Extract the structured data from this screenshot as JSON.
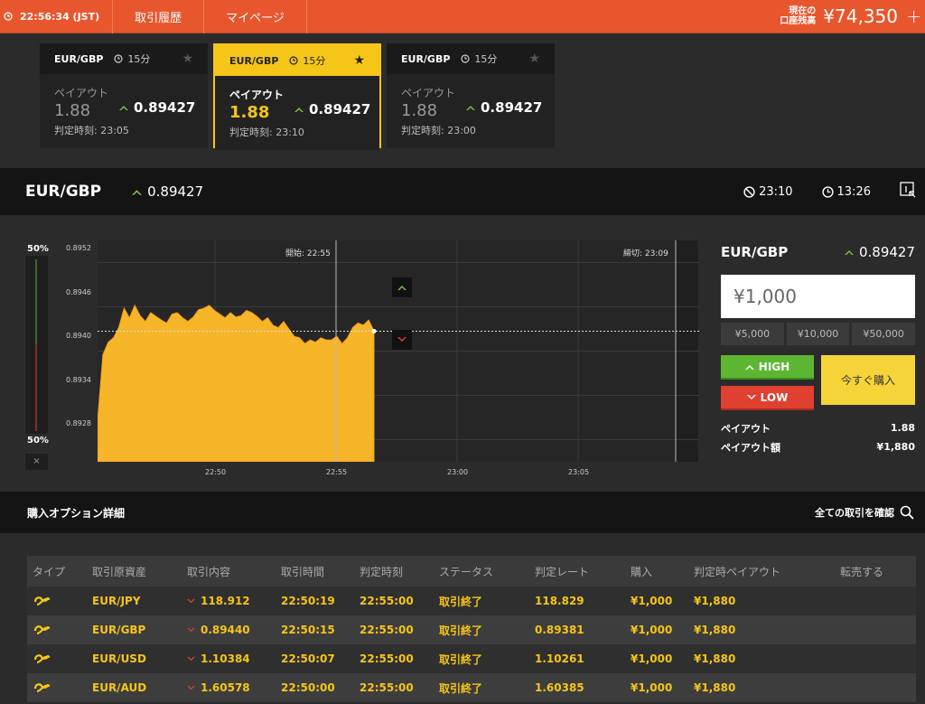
{
  "topbar": {
    "time": "22:56:34 (JST)",
    "nav_history": "取引履歴",
    "nav_mypage": "マイページ",
    "balance_label_1": "現在の",
    "balance_label_2": "口座残高",
    "balance_value": "¥74,350",
    "plus": "+"
  },
  "cards": [
    {
      "pair": "EUR/GBP",
      "duration": "15分",
      "payout_label": "ペイアウト",
      "payout": "1.88",
      "rate": "0.89427",
      "judge_label": "判定時刻: 23:05",
      "active": false
    },
    {
      "pair": "EUR/GBP",
      "duration": "15分",
      "payout_label": "ペイアウト",
      "payout": "1.88",
      "rate": "0.89427",
      "judge_label": "判定時刻: 23:10",
      "active": true
    },
    {
      "pair": "EUR/GBP",
      "duration": "15分",
      "payout_label": "ペイアウト",
      "payout": "1.88",
      "rate": "0.89427",
      "judge_label": "判定時刻: 23:00",
      "active": false
    }
  ],
  "assetbar": {
    "name": "EUR/GBP",
    "rate": "0.89427",
    "close_time": "23:10",
    "remaining": "13:26"
  },
  "chart": {
    "left_top_pct": "50%",
    "left_bottom_pct": "50%",
    "close_x": "×",
    "start_label": "開始: 22:55",
    "end_label": "締切: 23:09",
    "y_ticks": [
      "0.8952",
      "0.8946",
      "0.8940",
      "0.8934",
      "0.8928"
    ],
    "x_ticks": [
      "22:50",
      "22:55",
      "23:00",
      "23:05"
    ]
  },
  "chart_data": {
    "type": "area",
    "title": "",
    "xlabel": "",
    "ylabel": "",
    "ylim": [
      0.8925,
      0.8955
    ],
    "x": [
      "22:50",
      "22:55",
      "23:00",
      "23:05"
    ],
    "series": [
      {
        "values": [
          0.89305,
          0.89395,
          0.89412,
          0.89418,
          0.89432,
          0.89458,
          0.89445,
          0.89462,
          0.89448,
          0.8944,
          0.89452,
          0.89447,
          0.89442,
          0.89438,
          0.8945,
          0.89452,
          0.89445,
          0.8944,
          0.89446,
          0.89456,
          0.89458,
          0.89462,
          0.89455,
          0.8945,
          0.89445,
          0.89452,
          0.89446,
          0.89448,
          0.89455,
          0.89452,
          0.89447,
          0.8944,
          0.89445,
          0.89435,
          0.89432,
          0.8944,
          0.8943,
          0.8942,
          0.89418,
          0.8941,
          0.89415,
          0.89412,
          0.89418,
          0.89415,
          0.89415,
          0.8942,
          0.8941,
          0.89418,
          0.89432,
          0.89438,
          0.89435,
          0.89442,
          0.89427
        ]
      }
    ],
    "current_rate": 0.89427
  },
  "trade": {
    "name": "EUR/GBP",
    "rate": "0.89427",
    "amount": "¥1,000",
    "presets": [
      "¥5,000",
      "¥10,000",
      "¥50,000"
    ],
    "high": "HIGH",
    "low": "LOW",
    "buy": "今すぐ購入",
    "payout_label": "ペイアウト",
    "payout_value": "1.88",
    "payout_amount_label": "ペイアウト額",
    "payout_amount_value": "¥1,880"
  },
  "details": {
    "title": "購入オプション詳細",
    "all_link": "全ての取引を確認"
  },
  "table": {
    "headers": [
      "タイプ",
      "取引原資産",
      "取引内容",
      "取引時間",
      "判定時刻",
      "ステータス",
      "判定レート",
      "購入",
      "判定時ペイアウト",
      "転売する"
    ],
    "rows": [
      [
        "EUR/JPY",
        "118.912",
        "22:50:19",
        "22:55:00",
        "取引終了",
        "118.829",
        "¥1,000",
        "¥1,880"
      ],
      [
        "EUR/GBP",
        "0.89440",
        "22:50:15",
        "22:55:00",
        "取引終了",
        "0.89381",
        "¥1,000",
        "¥1,880"
      ],
      [
        "EUR/USD",
        "1.10384",
        "22:50:07",
        "22:55:00",
        "取引終了",
        "1.10261",
        "¥1,000",
        "¥1,880"
      ],
      [
        "EUR/AUD",
        "1.60578",
        "22:50:00",
        "22:55:00",
        "取引終了",
        "1.60385",
        "¥1,000",
        "¥1,880"
      ]
    ]
  },
  "colors": {
    "topbar": "#e8562e",
    "accent_yellow": "#f5c518",
    "high_green": "#5db632",
    "low_red": "#e04030",
    "area_fill": "#f7b52a"
  },
  "icons": [
    "clock-icon",
    "star-icon",
    "up-arrow-icon",
    "down-arrow-icon",
    "no-entry-icon",
    "timer-icon",
    "cursor-box-icon",
    "search-icon",
    "trade-type-icon"
  ]
}
